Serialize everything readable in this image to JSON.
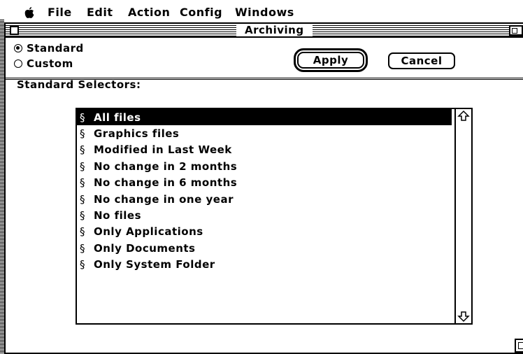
{
  "menubar": {
    "apple_icon": "apple-logo-icon",
    "items": [
      "File",
      "Edit",
      "Action",
      "Config",
      "Windows"
    ]
  },
  "window": {
    "title": "Archiving"
  },
  "options": {
    "standard_label": "Standard",
    "custom_label": "Custom",
    "selected": "Standard"
  },
  "buttons": {
    "apply_label": "Apply",
    "cancel_label": "Cancel"
  },
  "selectors": {
    "heading": "Standard Selectors:",
    "marker": "§",
    "items": [
      "All files",
      "Graphics files",
      "Modified in Last Week",
      "No change in 2 months",
      "No change in 6 months",
      "No change in one year",
      "No files",
      "Only Applications",
      "Only Documents",
      "Only System Folder"
    ],
    "selected_index": 0
  }
}
